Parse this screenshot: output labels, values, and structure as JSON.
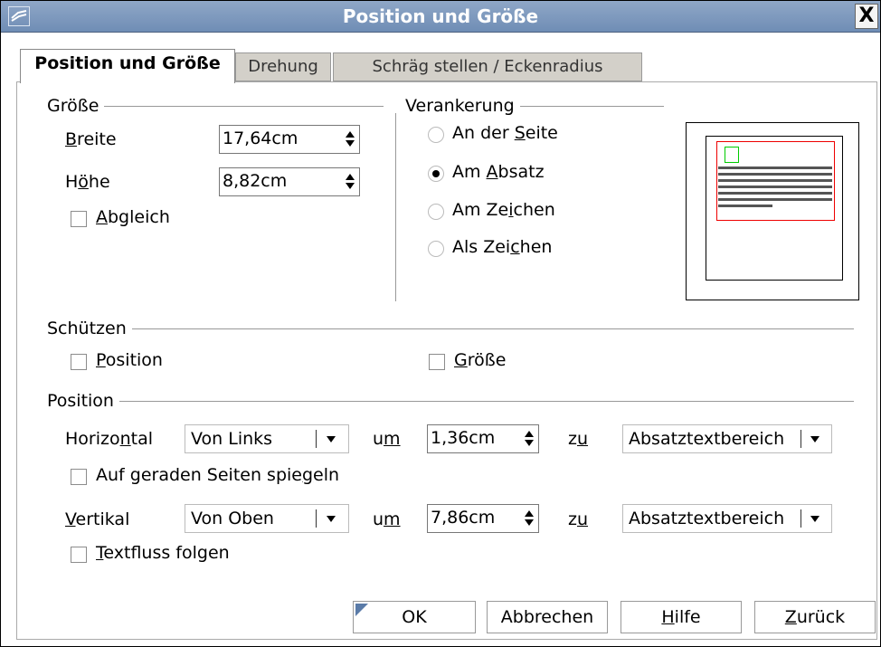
{
  "window": {
    "title": "Position und Größe",
    "close_label": "X"
  },
  "tabs": [
    {
      "label": "Position und Größe"
    },
    {
      "label": "Drehung"
    },
    {
      "label": "Schräg stellen / Eckenradius"
    }
  ],
  "groesse": {
    "group_label": "Größe",
    "breite": {
      "label_pre": "",
      "label_ul": "B",
      "label_post": "reite",
      "value": "17,64cm"
    },
    "hoehe": {
      "label_pre": "H",
      "label_ul": "ö",
      "label_post": "he",
      "value": "8,82cm"
    },
    "abgleich": {
      "label_ul": "A",
      "label_post": "bgleich",
      "checked": false
    }
  },
  "verankerung": {
    "group_label": "Verankerung",
    "options": [
      {
        "pre": "An der ",
        "ul": "S",
        "post": "eite",
        "selected": false
      },
      {
        "pre": "Am ",
        "ul": "A",
        "post": "bsatz",
        "selected": true
      },
      {
        "pre": "Am Ze",
        "ul": "i",
        "post": "chen",
        "selected": false
      },
      {
        "pre": "Als Zei",
        "ul": "c",
        "post": "hen",
        "selected": false
      }
    ]
  },
  "schuetzen": {
    "group_label": "Schützen",
    "position": {
      "ul": "P",
      "post": "osition",
      "checked": false
    },
    "groesse": {
      "ul": "G",
      "post": "röße",
      "checked": false
    }
  },
  "position": {
    "group_label": "Position",
    "horizontal": {
      "pre": "Horizo",
      "ul": "n",
      "post": "tal",
      "mode": "Von Links",
      "um_pre": "u",
      "um_ul": "m",
      "value": "1,36cm",
      "zu_pre": "z",
      "zu_ul": "u",
      "target": "Absatztextbereich"
    },
    "spiegeln": {
      "pre": "Auf geraden Seiten spie",
      "ul": "g",
      "post": "eln",
      "checked": false
    },
    "vertikal": {
      "pre": "",
      "ul": "V",
      "post": "ertikal",
      "mode": "Von Oben",
      "um_pre": "u",
      "um_ul": "m",
      "value": "7,86cm",
      "zu_pre": "z",
      "zu_ul": "u",
      "target": "Absatztextbereich"
    },
    "textfluss": {
      "ul": "T",
      "post": "extfluss folgen",
      "checked": false
    }
  },
  "buttons": {
    "ok": "OK",
    "cancel": "Abbrechen",
    "help_ul": "H",
    "help_post": "ilfe",
    "back_ul": "Z",
    "back_post": "urück"
  },
  "colors": {
    "titlebar": "#7b97bd",
    "preview_frame": "#e00000",
    "preview_anchor": "#00cc00"
  }
}
